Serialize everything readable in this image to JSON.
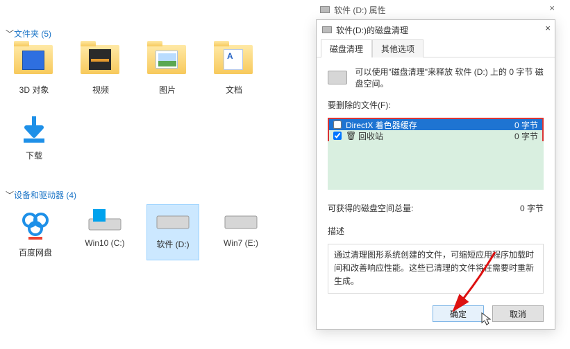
{
  "parent_window": {
    "title": "软件 (D:) 属性"
  },
  "explorer": {
    "sections": [
      {
        "label": "文件夹 (5)",
        "items": [
          {
            "label": "3D 对象"
          },
          {
            "label": "视频"
          },
          {
            "label": "图片"
          },
          {
            "label": "文档"
          },
          {
            "label": "下载"
          }
        ]
      },
      {
        "label": "设备和驱动器 (4)",
        "items": [
          {
            "label": "百度网盘"
          },
          {
            "label": "Win10 (C:)"
          },
          {
            "label": "软件 (D:)",
            "selected": true
          },
          {
            "label": "Win7 (E:)"
          }
        ]
      }
    ]
  },
  "dialog": {
    "title": "软件(D:)的磁盘清理",
    "close_glyph": "×",
    "tabs": [
      {
        "label": "磁盘清理",
        "active": true
      },
      {
        "label": "其他选项",
        "active": false
      }
    ],
    "info_text": "可以使用\"磁盘清理\"来释放 软件 (D:) 上的 0 字节 磁盘空间。",
    "files_label": "要删除的文件(F):",
    "files": [
      {
        "name": "DirectX 着色器缓存",
        "size": "0 字节",
        "checked": false,
        "selected": true
      },
      {
        "name": "回收站",
        "size": "0 字节",
        "checked": true,
        "selected": false
      }
    ],
    "gain_label": "可获得的磁盘空间总量:",
    "gain_value": "0 字节",
    "desc_label": "描述",
    "desc_text": "通过清理图形系统创建的文件，可缩短应用程序加载时间和改善响应性能。这些已清理的文件将在需要时重新生成。",
    "ok_label": "确定",
    "cancel_label": "取消"
  }
}
